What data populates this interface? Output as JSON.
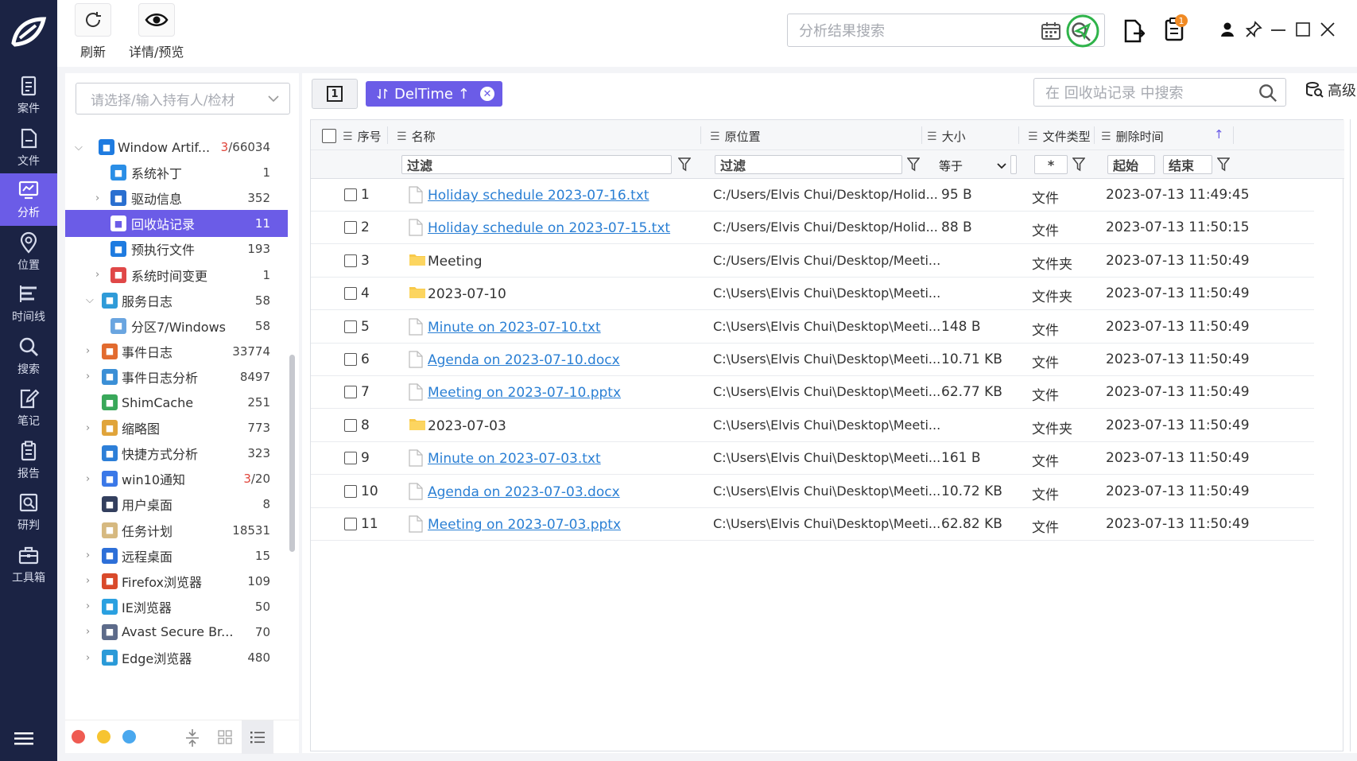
{
  "nav": {
    "items": [
      {
        "label": "案件",
        "icon": "case-icon"
      },
      {
        "label": "文件",
        "icon": "file-icon"
      },
      {
        "label": "分析",
        "icon": "analysis-icon"
      },
      {
        "label": "位置",
        "icon": "location-icon"
      },
      {
        "label": "时间线",
        "icon": "timeline-icon"
      },
      {
        "label": "搜索",
        "icon": "search-icon"
      },
      {
        "label": "笔记",
        "icon": "note-icon"
      },
      {
        "label": "报告",
        "icon": "report-icon"
      },
      {
        "label": "研判",
        "icon": "judge-icon"
      },
      {
        "label": "工具箱",
        "icon": "toolbox-icon"
      }
    ],
    "active_index": 2
  },
  "toolbar": {
    "refresh_label": "刷新",
    "preview_label": "详情/预览",
    "search_placeholder": "分析结果搜索",
    "notification_count": "1"
  },
  "left": {
    "selector_placeholder": "请选择/输入持有人/检材",
    "tree": [
      {
        "label": "Window Artif...",
        "count_red": "3",
        "count": "/66034",
        "level": 0,
        "arrow": "v"
      },
      {
        "label": "系统补丁",
        "count": "1",
        "level": 2,
        "arrow": ""
      },
      {
        "label": "驱动信息",
        "count": "352",
        "level": 2,
        "arrow": ">"
      },
      {
        "label": "回收站记录",
        "count": "11",
        "level": 2,
        "arrow": "",
        "active": true
      },
      {
        "label": "预执行文件",
        "count": "193",
        "level": 2,
        "arrow": ""
      },
      {
        "label": "系统时间变更",
        "count": "1",
        "level": 2,
        "arrow": ">"
      },
      {
        "label": "服务日志",
        "count": "58",
        "level": 1,
        "arrow": "v"
      },
      {
        "label": "分区7/Windows",
        "count": "58",
        "level": 2,
        "arrow": ""
      },
      {
        "label": "事件日志",
        "count": "33774",
        "level": 1,
        "arrow": ">"
      },
      {
        "label": "事件日志分析",
        "count": "8497",
        "level": 1,
        "arrow": ">"
      },
      {
        "label": "ShimCache",
        "count": "251",
        "level": 1,
        "arrow": ""
      },
      {
        "label": "缩略图",
        "count": "773",
        "level": 1,
        "arrow": ">"
      },
      {
        "label": "快捷方式分析",
        "count": "323",
        "level": 1,
        "arrow": ""
      },
      {
        "label": "win10通知",
        "count_red": "3",
        "count": "/20",
        "level": 1,
        "arrow": ">"
      },
      {
        "label": "用户桌面",
        "count": "8",
        "level": 1,
        "arrow": ""
      },
      {
        "label": "任务计划",
        "count": "18531",
        "level": 1,
        "arrow": ""
      },
      {
        "label": "远程桌面",
        "count": "15",
        "level": 1,
        "arrow": ">"
      },
      {
        "label": "Firefox浏览器",
        "count": "109",
        "level": 1,
        "arrow": ">"
      },
      {
        "label": "IE浏览器",
        "count": "50",
        "level": 1,
        "arrow": ">"
      },
      {
        "label": "Avast Secure Br...",
        "count": "70",
        "level": 1,
        "arrow": ">"
      },
      {
        "label": "Edge浏览器",
        "count": "480",
        "level": 1,
        "arrow": ">"
      }
    ]
  },
  "main": {
    "tab_number": "1",
    "sort_tag": "DelTime ↑",
    "search_placeholder": "在 回收站记录 中搜索",
    "advanced_label": "高级",
    "columns": {
      "index": "序号",
      "name": "名称",
      "location": "原位置",
      "size": "大小",
      "type": "文件类型",
      "time": "删除时间"
    },
    "filters": {
      "name": "过滤",
      "location": "过滤",
      "size_op": "等于",
      "type": "*",
      "start": "起始",
      "end": "结束"
    },
    "rows": [
      {
        "n": "1",
        "name": "Holiday schedule 2023-07-16.txt",
        "loc": "C:/Users/Elvis Chui/Desktop/Holid...",
        "size": "95 B",
        "type": "文件",
        "time": "2023-07-13 11:49:45",
        "kind": "file"
      },
      {
        "n": "2",
        "name": "Holiday schedule on 2023-07-15.txt",
        "loc": "C:/Users/Elvis Chui/Desktop/Holid...",
        "size": "88 B",
        "type": "文件",
        "time": "2023-07-13 11:50:15",
        "kind": "file"
      },
      {
        "n": "3",
        "name": "Meeting",
        "loc": "C:/Users/Elvis Chui/Desktop/Meeti...",
        "size": "",
        "type": "文件夹",
        "time": "2023-07-13 11:50:49",
        "kind": "folder"
      },
      {
        "n": "4",
        "name": "2023-07-10",
        "loc": "C:\\Users\\Elvis Chui\\Desktop\\Meeti...",
        "size": "",
        "type": "文件夹",
        "time": "2023-07-13 11:50:49",
        "kind": "folder"
      },
      {
        "n": "5",
        "name": "Minute on 2023-07-10.txt",
        "loc": "C:\\Users\\Elvis Chui\\Desktop\\Meeti...",
        "size": "148 B",
        "type": "文件",
        "time": "2023-07-13 11:50:49",
        "kind": "file"
      },
      {
        "n": "6",
        "name": "Agenda on 2023-07-10.docx",
        "loc": "C:\\Users\\Elvis Chui\\Desktop\\Meeti...",
        "size": "10.71 KB",
        "type": "文件",
        "time": "2023-07-13 11:50:49",
        "kind": "file"
      },
      {
        "n": "7",
        "name": "Meeting on 2023-07-10.pptx",
        "loc": "C:\\Users\\Elvis Chui\\Desktop\\Meeti...",
        "size": "62.77 KB",
        "type": "文件",
        "time": "2023-07-13 11:50:49",
        "kind": "file"
      },
      {
        "n": "8",
        "name": "2023-07-03",
        "loc": "C:\\Users\\Elvis Chui\\Desktop\\Meeti...",
        "size": "",
        "type": "文件夹",
        "time": "2023-07-13 11:50:49",
        "kind": "folder"
      },
      {
        "n": "9",
        "name": "Minute on 2023-07-03.txt",
        "loc": "C:\\Users\\Elvis Chui\\Desktop\\Meeti...",
        "size": "161 B",
        "type": "文件",
        "time": "2023-07-13 11:50:49",
        "kind": "file"
      },
      {
        "n": "10",
        "name": "Agenda on 2023-07-03.docx",
        "loc": "C:\\Users\\Elvis Chui\\Desktop\\Meeti...",
        "size": "10.72 KB",
        "type": "文件",
        "time": "2023-07-13 11:50:49",
        "kind": "file"
      },
      {
        "n": "11",
        "name": "Meeting on 2023-07-03.pptx",
        "loc": "C:\\Users\\Elvis Chui\\Desktop\\Meeti...",
        "size": "62.82 KB",
        "type": "文件",
        "time": "2023-07-13 11:50:49",
        "kind": "file"
      }
    ]
  },
  "colors": {
    "nav_bg": "#1b2344",
    "accent": "#6b5ce7",
    "link": "#2a7fd4",
    "count_red": "#e0453a",
    "status_green": "#2fb34a"
  }
}
